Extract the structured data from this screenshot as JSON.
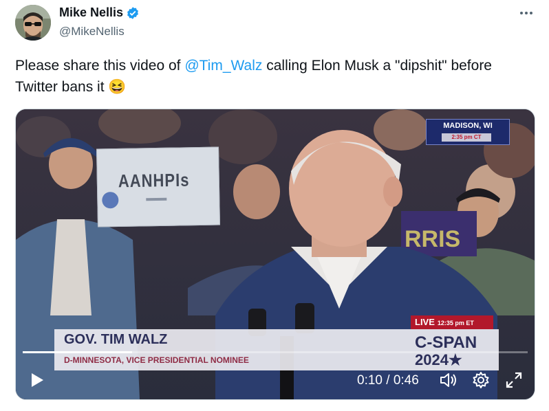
{
  "author": {
    "name": "Mike Nellis",
    "handle": "@MikeNellis",
    "verified": true
  },
  "tweet": {
    "text_before": "Please share this video of ",
    "mention": "@Tim_Walz",
    "text_after": " calling Elon Musk a \"dipshit\" before Twitter bans it ",
    "emoji": "😆"
  },
  "video": {
    "location": "MADISON, WI",
    "location_time": "2:35 pm CT",
    "sign_text": "AANHPIs",
    "background_sign_text": "RRIS",
    "lower_third_name": "GOV. TIM WALZ",
    "lower_third_subtitle": "D-MINNESOTA, VICE PRESIDENTIAL NOMINEE",
    "live_label": "LIVE",
    "live_time": "12:35 pm ET",
    "network": "C-SPAN",
    "network_year": "2024★",
    "current_time": "0:10",
    "separator": "/",
    "duration": "0:46",
    "progress_fraction": 0.217
  },
  "icons": {
    "verified": "verified-badge-icon",
    "more": "more-icon",
    "play": "play-icon",
    "volume": "volume-icon",
    "settings": "gear-icon",
    "fullscreen": "fullscreen-icon"
  },
  "colors": {
    "link": "#1d9bf0",
    "verified": "#1d9bf0",
    "live": "#b2182b"
  }
}
